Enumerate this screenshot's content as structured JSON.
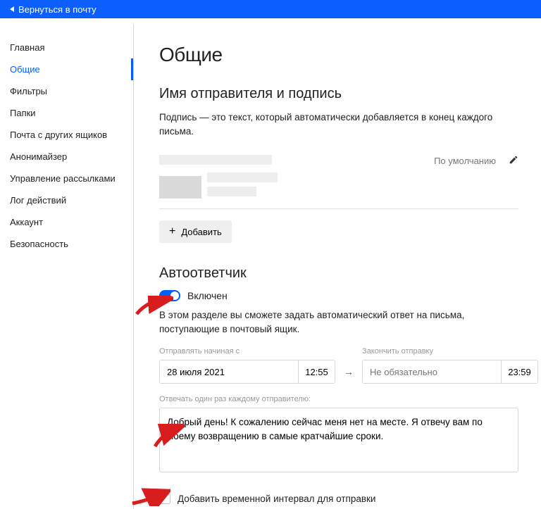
{
  "topbar": {
    "back_label": "Вернуться в почту"
  },
  "sidebar": {
    "items": [
      {
        "id": "main",
        "label": "Главная",
        "active": false
      },
      {
        "id": "general",
        "label": "Общие",
        "active": true
      },
      {
        "id": "filters",
        "label": "Фильтры",
        "active": false
      },
      {
        "id": "folders",
        "label": "Папки",
        "active": false
      },
      {
        "id": "othermail",
        "label": "Почта с других ящиков",
        "active": false
      },
      {
        "id": "anon",
        "label": "Анонимайзер",
        "active": false
      },
      {
        "id": "subs",
        "label": "Управление рассылками",
        "active": false
      },
      {
        "id": "log",
        "label": "Лог действий",
        "active": false
      },
      {
        "id": "account",
        "label": "Аккаунт",
        "active": false
      },
      {
        "id": "security",
        "label": "Безопасность",
        "active": false
      }
    ]
  },
  "page": {
    "title": "Общие",
    "section_signature": {
      "heading": "Имя отправителя и подпись",
      "description": "Подпись — это текст, который автоматически добавляется в конец каждого письма.",
      "default_label": "По умолчанию",
      "add_label": "Добавить"
    },
    "section_autoreply": {
      "heading": "Автоответчик",
      "enabled": true,
      "enabled_label": "Включен",
      "description": "В этом разделе вы сможете задать автоматический ответ на письма, поступающие в почтовый ящик.",
      "start_label": "Отправлять начиная с",
      "start_date": "28 июля 2021",
      "start_time": "12:55",
      "arrow": "→",
      "end_label": "Закончить отправку",
      "end_date_placeholder": "Не обязательно",
      "end_time": "23:59",
      "message_label": "Отвечать один раз каждому отправителю:",
      "message": "Добрый день! К сожалению сейчас меня нет на месте. Я отвечу вам по моему возвращению в самые кратчайшие сроки.",
      "interval_checkbox_label": "Добавить временной интервал для отправки",
      "interval_checked": false
    }
  },
  "colors": {
    "accent": "#005ff9",
    "annotation": "#d71d1e"
  }
}
